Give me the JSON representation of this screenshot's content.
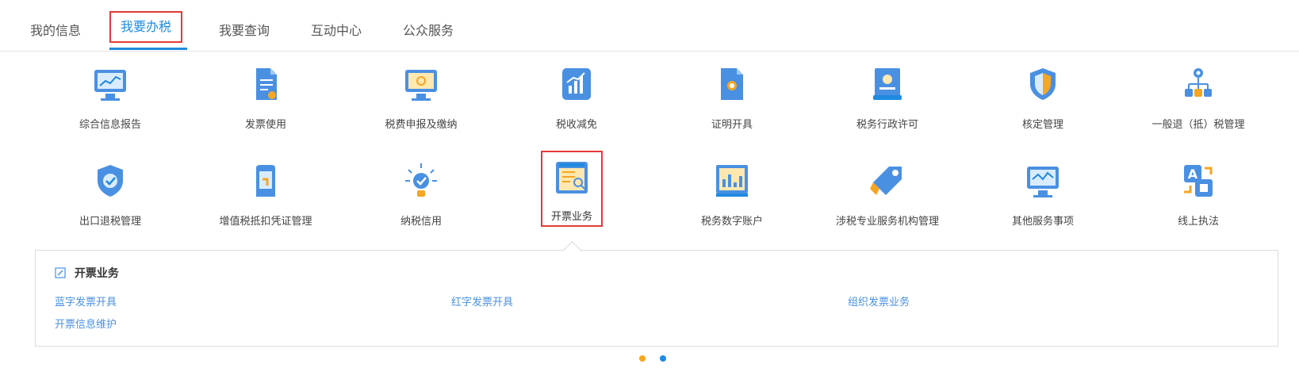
{
  "tabs": [
    {
      "label": "我的信息"
    },
    {
      "label": "我要办税"
    },
    {
      "label": "我要查询"
    },
    {
      "label": "互动中心"
    },
    {
      "label": "公众服务"
    }
  ],
  "services_row1": [
    {
      "label": "综合信息报告",
      "icon": "monitor-chart-icon"
    },
    {
      "label": "发票使用",
      "icon": "document-icon"
    },
    {
      "label": "税费申报及缴纳",
      "icon": "monitor-icon"
    },
    {
      "label": "税收减免",
      "icon": "bar-chart-icon"
    },
    {
      "label": "证明开具",
      "icon": "certificate-icon"
    },
    {
      "label": "税务行政许可",
      "icon": "license-icon"
    },
    {
      "label": "核定管理",
      "icon": "shield-icon"
    },
    {
      "label": "一般退（抵）税管理",
      "icon": "org-tree-icon"
    }
  ],
  "services_row2": [
    {
      "label": "出口退税管理",
      "icon": "shield-check-icon"
    },
    {
      "label": "增值税抵扣凭证管理",
      "icon": "document-hand-icon"
    },
    {
      "label": "纳税信用",
      "icon": "lightbulb-icon"
    },
    {
      "label": "开票业务",
      "icon": "invoice-window-icon"
    },
    {
      "label": "税务数字账户",
      "icon": "dashboard-icon"
    },
    {
      "label": "涉税专业服务机构管理",
      "icon": "tag-icon"
    },
    {
      "label": "其他服务事项",
      "icon": "monitor-wave-icon"
    },
    {
      "label": "线上执法",
      "icon": "translate-icon"
    }
  ],
  "panel": {
    "title": "开票业务",
    "links": [
      "蓝字发票开具",
      "红字发票开具",
      "组织发票业务",
      "开票信息维护"
    ]
  },
  "colors": {
    "accent": "#1f8ae0",
    "highlight": "#e53935",
    "link": "#4a90e2",
    "dot_orange": "#f5a623",
    "dot_blue": "#1f8ae0"
  }
}
